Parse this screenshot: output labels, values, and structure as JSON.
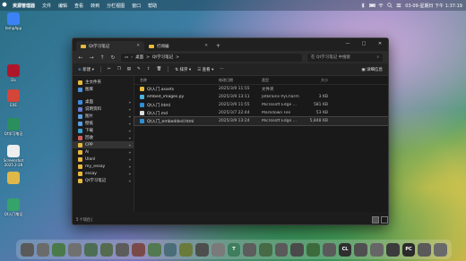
{
  "menubar": {
    "apple": "",
    "items": [
      "资源管理器",
      "文件",
      "编辑",
      "查看",
      "转到",
      "分栏视图",
      "窗口",
      "帮助"
    ],
    "datetime": "03-09-星期日 下午 1:37:19"
  },
  "desktop_icons": [
    {
      "label": "tempApp",
      "color": "#3b82f6"
    },
    {
      "label": "Dx",
      "color": "#b0162a"
    },
    {
      "label": "EXE",
      "color": "#d4463a"
    },
    {
      "label": "Qt学习笔记",
      "color": "#2a8f5d"
    },
    {
      "label": "Screenshot\n2025 2-28",
      "color": "#eeeeee"
    },
    {
      "label": "",
      "color": "#e0b84a"
    },
    {
      "label": "Qt入门笔记",
      "color": "#35a36a"
    }
  ],
  "window": {
    "tabs": [
      {
        "label": "Qt学习笔记",
        "active": true
      },
      {
        "label": "打阅编",
        "active": false
      }
    ],
    "controls": {
      "minimize": "—",
      "maximize": "□",
      "close": "✕"
    },
    "address": {
      "parts": [
        "桌面",
        ">",
        "Qt学习笔记",
        ">"
      ]
    },
    "search_placeholder": "在 Qt学习笔记 中搜索",
    "commands": {
      "new": "新建",
      "sort": "排序",
      "view": "查看",
      "more": "···",
      "details": "详细信息"
    },
    "sidebar": [
      {
        "label": "主文件夹",
        "color": "#e7b93d",
        "pin": false
      },
      {
        "label": "图库",
        "color": "#4a90d9",
        "pin": false
      },
      {
        "gap": true
      },
      {
        "label": "桌面",
        "color": "#3d8be0",
        "pin": true
      },
      {
        "label": "说明资料",
        "color": "#6a7ad0",
        "pin": true
      },
      {
        "label": "图片",
        "color": "#5aa0e0",
        "pin": true
      },
      {
        "label": "壁纸",
        "color": "#5aa0e0",
        "pin": true
      },
      {
        "label": "下载",
        "color": "#3aa0d0",
        "pin": true
      },
      {
        "label": "回收",
        "color": "#d45c5c",
        "pin": true
      },
      {
        "label": "CPP",
        "color": "#e7b93d",
        "pin": true,
        "selected": true
      },
      {
        "label": "Ai",
        "color": "#e7b93d",
        "pin": true
      },
      {
        "label": "Ulanl",
        "color": "#e7b93d",
        "pin": true
      },
      {
        "label": "my_essay",
        "color": "#e7b93d",
        "pin": true
      },
      {
        "label": "essay",
        "color": "#e7b93d",
        "pin": true
      },
      {
        "label": "Qt学习笔记",
        "color": "#e7b93d",
        "pin": true
      }
    ],
    "columns": {
      "name": "名称",
      "date": "修改日期",
      "type": "类型",
      "size": "大小"
    },
    "files": [
      {
        "name": "Qt入门.assets",
        "date": "2025/3/9 11:55",
        "type": "文件夹",
        "size": "",
        "icon": "#e7b93d",
        "selected": false
      },
      {
        "name": "embed_images.py",
        "date": "2025/3/9 13:11",
        "type": "JetBrains PyCharm",
        "size": "3 KB",
        "icon": "#4bb3e0",
        "selected": false
      },
      {
        "name": "Qt入门.html",
        "date": "2025/3/9 11:55",
        "type": "Microsoft Edge ...",
        "size": "581 KB",
        "icon": "#2f8fd6",
        "selected": false
      },
      {
        "name": "Qt入门.md",
        "date": "2025/3/7 22:44",
        "type": "Markdown File",
        "size": "53 KB",
        "icon": "#dddddd",
        "selected": false
      },
      {
        "name": "Qt入门_embedded.html",
        "date": "2025/3/9 13:24",
        "type": "Microsoft Edge ...",
        "size": "5,848 KB",
        "icon": "#2f8fd6",
        "selected": true
      }
    ],
    "status": "5 个项目  |"
  },
  "dock": [
    {
      "name": "finder",
      "color": "#5a5a5a"
    },
    {
      "name": "app-2",
      "color": "#6b6b6b"
    },
    {
      "name": "app-3",
      "color": "#4a7a4a"
    },
    {
      "name": "app-4",
      "color": "#707070"
    },
    {
      "name": "app-5",
      "color": "#4d6e55"
    },
    {
      "name": "app-6",
      "color": "#556b4f"
    },
    {
      "name": "app-7",
      "color": "#5c5c5c"
    },
    {
      "name": "app-8",
      "color": "#7a4a4a"
    },
    {
      "name": "app-9",
      "color": "#52794f"
    },
    {
      "name": "app-10",
      "color": "#4b6d7a"
    },
    {
      "name": "app-11",
      "color": "#6a7a3a"
    },
    {
      "name": "app-12",
      "color": "#4e4e4e"
    },
    {
      "name": "app-13",
      "color": "#7a7a7a"
    },
    {
      "name": "app-14",
      "color": "#3e7d5e"
    },
    {
      "name": "app-15",
      "color": "#5d5d5d"
    },
    {
      "name": "app-16",
      "color": "#476a47"
    },
    {
      "name": "app-17",
      "color": "#5a5a5a"
    },
    {
      "name": "app-18",
      "color": "#4a4a4a"
    },
    {
      "name": "app-19",
      "color": "#3d6a3d"
    },
    {
      "name": "app-20",
      "color": "#5a5a5a"
    },
    {
      "name": "app-21",
      "color": "#2f2f2f"
    },
    {
      "name": "app-22",
      "color": "#4f4f4f"
    },
    {
      "name": "app-23",
      "color": "#666666"
    },
    {
      "name": "app-24",
      "color": "#3b3b3b"
    },
    {
      "name": "app-25",
      "color": "#2a2a2a"
    },
    {
      "name": "app-26",
      "color": "#5a5a5a"
    },
    {
      "name": "app-27",
      "color": "#6a6a6a"
    }
  ],
  "dock_labels": {
    "t": "T",
    "cl": "CL",
    "pc": "PC"
  }
}
